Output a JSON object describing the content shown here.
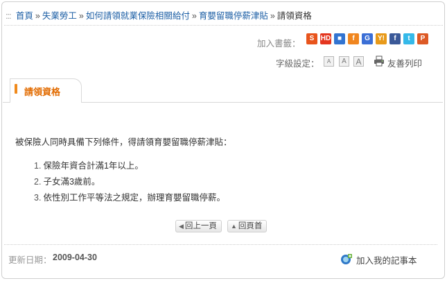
{
  "breadcrumb": {
    "prefix": ":::",
    "items": [
      "首頁",
      "失業勞工",
      "如何請領就業保險相關給付",
      "育嬰留職停薪津貼"
    ],
    "separator": "»",
    "current": "請領資格"
  },
  "bookmarks": {
    "label": "加入書籤：",
    "icons": [
      {
        "name": "hemidemi-bookmark",
        "glyph": "S",
        "color": "#e8541c"
      },
      {
        "name": "hd-bookmark",
        "glyph": "HD",
        "color": "#e4361f"
      },
      {
        "name": "delicious-bookmark",
        "glyph": "■",
        "color": "#3274d1"
      },
      {
        "name": "funp-bookmark",
        "glyph": "f",
        "color": "#f0861f"
      },
      {
        "name": "google-bookmark",
        "glyph": "G",
        "color": "#3b6fd6"
      },
      {
        "name": "yahoo-bookmark",
        "glyph": "Y!",
        "color": "#e89a1a"
      },
      {
        "name": "facebook-bookmark",
        "glyph": "f",
        "color": "#3b5998"
      },
      {
        "name": "twitter-bookmark",
        "glyph": "t",
        "color": "#35b9e9"
      },
      {
        "name": "plurk-bookmark",
        "glyph": "P",
        "color": "#dd5a26"
      }
    ]
  },
  "font_size": {
    "label": "字級設定：",
    "options": [
      "A",
      "A",
      "A"
    ]
  },
  "print": {
    "label": "友善列印"
  },
  "section_tab": {
    "title": "請領資格",
    "accent": "#e26b00"
  },
  "content": {
    "intro": "被保險人同時具備下列條件，得請領育嬰留職停薪津貼：",
    "items": [
      {
        "num": "1.",
        "text": "保險年資合計滿1年以上。"
      },
      {
        "num": "2.",
        "text": "子女滿3歲前。"
      },
      {
        "num": "3.",
        "text": "依性別工作平等法之規定，辦理育嬰留職停薪。"
      }
    ]
  },
  "page_nav": {
    "back": {
      "label": "回上一頁",
      "icon": "◀"
    },
    "top": {
      "label": "回頁首",
      "icon": "▲"
    }
  },
  "footer": {
    "update_label": "更新日期：",
    "update_date": "2009-04-30",
    "memo_label": "加入我的記事本"
  }
}
